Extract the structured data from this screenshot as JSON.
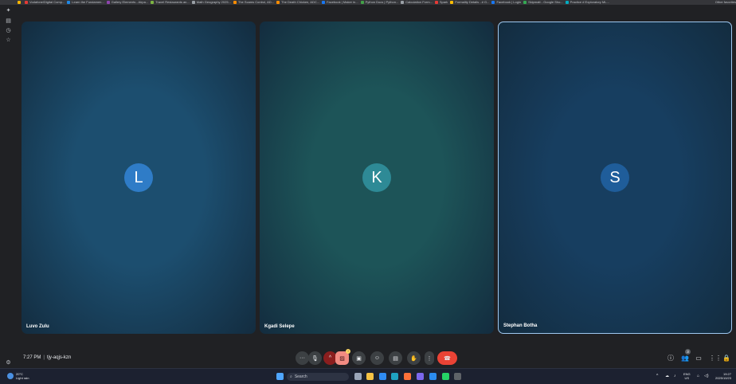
{
  "browser": {
    "bookmarks": [
      {
        "label": "",
        "color": "#f4b400"
      },
      {
        "label": "Vodafone/Digital Comp...",
        "color": "#e53935"
      },
      {
        "label": "Learn the Fundamen...",
        "color": "#1e88e5"
      },
      {
        "label": "Gallery Elements - Airpa...",
        "color": "#8e44ad"
      },
      {
        "label": "Travel Restaurants an...",
        "color": "#7cb342"
      },
      {
        "label": "Math Geography 2025...",
        "color": "#9aa0a6"
      },
      {
        "label": "The Scams Control, AD...",
        "color": "#fb8c00"
      },
      {
        "label": "The Death Chicken, ADC...",
        "color": "#fb8c00"
      },
      {
        "label": "Facebook | Maker in...",
        "color": "#1877f2"
      },
      {
        "label": "Python Docs | Python...",
        "color": "#43a047"
      },
      {
        "label": "Calculation Form...",
        "color": "#9aa0a6"
      },
      {
        "label": "Spark",
        "color": "#e53935"
      },
      {
        "label": "Formality Details - # G...",
        "color": "#fbbc04"
      },
      {
        "label": "Facebook | Login",
        "color": "#1877f2"
      },
      {
        "label": "Skipmatt - Google Sho...",
        "color": "#34a853"
      },
      {
        "label": "Practice # Exploratory ML...",
        "color": "#00acc1"
      }
    ],
    "extra_label": "Other favorites"
  },
  "meeting": {
    "time": "7:27 PM",
    "separator": "|",
    "code": "tjy-aqjs-kzn",
    "participant_count": "3",
    "camera_badge": "!",
    "participants": [
      {
        "name": "Luvo Zulu",
        "initial": "L",
        "tile_color": "#1c4e6f",
        "avatar_color": "#2f7cc7",
        "active": false
      },
      {
        "name": "Kgadi Selepe",
        "initial": "K",
        "tile_color": "#1d5458",
        "avatar_color": "#2e8a96",
        "active": false
      },
      {
        "name": "Stephan Botha",
        "initial": "S",
        "tile_color": "#173e60",
        "avatar_color": "#1f5d9a",
        "active": true
      }
    ]
  },
  "taskbar": {
    "weather_temp": "20°C",
    "weather_desc": "Light rain",
    "search_placeholder": "Search",
    "lang": "ENG",
    "region": "US",
    "time": "19:27",
    "date": "2025/10/23"
  }
}
